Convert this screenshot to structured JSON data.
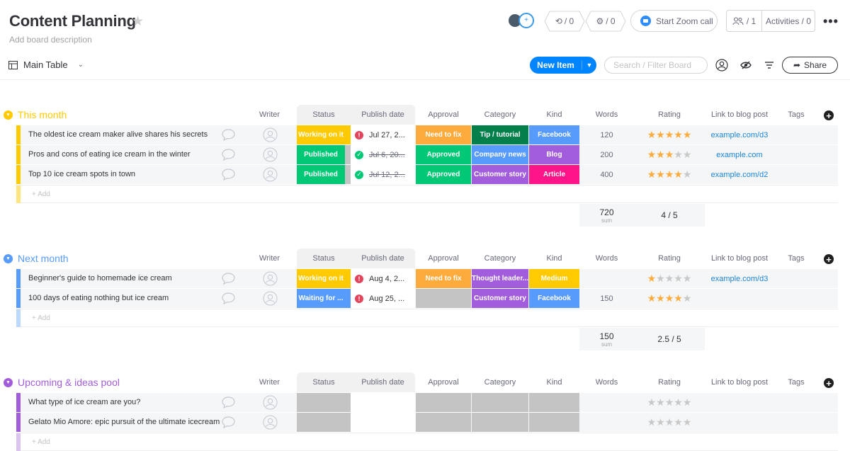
{
  "board": {
    "title": "Content Planning",
    "description": "Add board description",
    "view": "Main Table"
  },
  "toolbar": {
    "integrations_count": "/ 0",
    "automations_count": "/ 0",
    "zoom_label": "Start Zoom call",
    "members_count": "/ 1",
    "activities_label": "Activities / 0",
    "new_item_label": "New Item",
    "search_placeholder": "Search / Filter Board",
    "share_label": "Share"
  },
  "columns": [
    "Writer",
    "Status",
    "Publish date",
    "Approval",
    "Category",
    "Kind",
    "Words",
    "Rating",
    "Link to blog post",
    "Tags"
  ],
  "add_label": "+ Add",
  "sum_label": "sum",
  "colors": {
    "working": "#fdab3d",
    "working_yellow": "#ffcb00",
    "published": "#00c875",
    "need_fix": "#fdab3d",
    "approved": "#00c875",
    "tutorial": "#037f4c",
    "news": "#579bfc",
    "story": "#a25ddc",
    "facebook": "#579bfc",
    "blog": "#a25ddc",
    "article": "#ff158a",
    "medium": "#ffcb00",
    "waiting": "#579bfc",
    "thought": "#a25ddc",
    "empty": "#c4c4c4"
  },
  "groups": [
    {
      "name": "This month",
      "color": "#ffcb00",
      "rows": [
        {
          "name": "The oldest ice cream maker alive shares his secrets",
          "status": "Working on it",
          "status_color": "#ffcb00",
          "date": "Jul 27, 2...",
          "date_state": "alert",
          "approval": "Need to fix",
          "approval_color": "#fdab3d",
          "category": "Tip / tutorial",
          "category_color": "#037f4c",
          "kind": "Facebook",
          "kind_color": "#579bfc",
          "words": "120",
          "rating": 5,
          "link": "example.com/d3"
        },
        {
          "name": "Pros and cons of eating ice cream in the winter",
          "status": "Published",
          "status_color": "#00c875",
          "date": "Jul 6, 20...",
          "date_state": "done",
          "approval": "Approved",
          "approval_color": "#00c875",
          "category": "Company news",
          "category_color": "#579bfc",
          "kind": "Blog",
          "kind_color": "#a25ddc",
          "words": "200",
          "rating": 3,
          "link": "example.com"
        },
        {
          "name": "Top 10 ice cream spots in town",
          "status": "Published",
          "status_color": "#00c875",
          "date": "Jul 12, 2...",
          "date_state": "done",
          "approval": "Approved",
          "approval_color": "#00c875",
          "category": "Customer story",
          "category_color": "#a25ddc",
          "kind": "Article",
          "kind_color": "#ff158a",
          "words": "400",
          "rating": 4,
          "link": "example.com/d2"
        }
      ],
      "summary": {
        "words": "720",
        "rating": "4 / 5"
      }
    },
    {
      "name": "Next month",
      "color": "#579bfc",
      "rows": [
        {
          "name": "Beginner's guide to homemade ice cream",
          "status": "Working on it",
          "status_color": "#ffcb00",
          "date": "Aug 4, 2...",
          "date_state": "alert",
          "approval": "Need to fix",
          "approval_color": "#fdab3d",
          "category": "Thought leader...",
          "category_color": "#a25ddc",
          "kind": "Medium",
          "kind_color": "#ffcb00",
          "words": "",
          "rating": 1,
          "link": "example.com/d3"
        },
        {
          "name": "100 days of eating nothing but ice cream",
          "status": "Waiting for ...",
          "status_color": "#579bfc",
          "date": "Aug 25, ...",
          "date_state": "alert",
          "approval": "",
          "approval_color": "#c4c4c4",
          "category": "Customer story",
          "category_color": "#a25ddc",
          "kind": "Facebook",
          "kind_color": "#579bfc",
          "words": "150",
          "rating": 4,
          "link": ""
        }
      ],
      "summary": {
        "words": "150",
        "rating": "2.5 / 5"
      }
    },
    {
      "name": "Upcoming & ideas pool",
      "color": "#a25ddc",
      "rows": [
        {
          "name": "What type of ice cream are you?",
          "status": "",
          "status_color": "#c4c4c4",
          "date": "",
          "date_state": "none",
          "approval": "",
          "approval_color": "#c4c4c4",
          "category": "",
          "category_color": "#c4c4c4",
          "kind": "",
          "kind_color": "#c4c4c4",
          "words": "",
          "rating": 0,
          "link": ""
        },
        {
          "name": "Gelato Mio Amore: epic pursuit of the ultimate icecream",
          "status": "",
          "status_color": "#c4c4c4",
          "date": "",
          "date_state": "none",
          "approval": "",
          "approval_color": "#c4c4c4",
          "category": "",
          "category_color": "#c4c4c4",
          "kind": "",
          "kind_color": "#c4c4c4",
          "words": "",
          "rating": 0,
          "link": ""
        }
      ]
    }
  ]
}
